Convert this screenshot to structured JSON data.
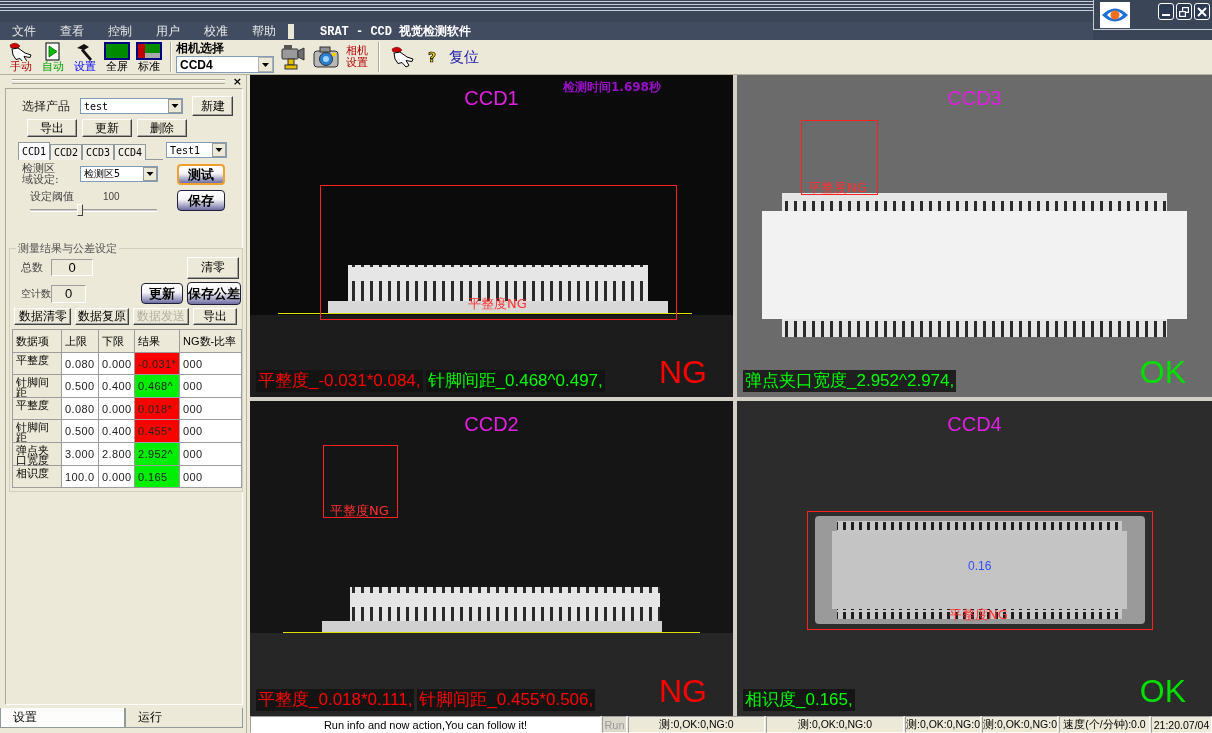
{
  "window": {
    "menu": [
      "文件",
      "查看",
      "控制",
      "用户",
      "校准",
      "帮助"
    ],
    "title": "SRAT - CCD 视觉检测软件"
  },
  "toolbar": {
    "modes": [
      "手动",
      "自动",
      "设置",
      "全屏",
      "标准"
    ],
    "camera_select": {
      "label": "相机选择",
      "value": "CCD4"
    },
    "camera_settings": "相机设置",
    "help": "?",
    "reset": "复位"
  },
  "side_panel": {
    "close": "×",
    "product": {
      "label": "选择产品",
      "value": "test"
    },
    "new_button": "新建",
    "product_buttons": [
      "导出",
      "更新",
      "删除"
    ],
    "ccd_tabs": [
      {
        "label": "CCD1",
        "selected": true
      },
      {
        "label": "CCD2",
        "selected": false
      },
      {
        "label": "CCD3",
        "selected": false
      },
      {
        "label": "CCD4",
        "selected": false
      }
    ],
    "test_select": "Test1",
    "region": {
      "label": "检测区域设定:",
      "value": "检测区5"
    },
    "threshold": {
      "label": "设定阈值",
      "reading": "100",
      "level": 0.39
    },
    "action_buttons": [
      {
        "label": "测试",
        "focused": true
      },
      {
        "label": "保存",
        "focused": false
      }
    ],
    "results": {
      "title": "测量结果与公差设定",
      "total": {
        "label": "总数",
        "value": "0"
      },
      "empty_count": {
        "label": "空计数",
        "value": "0"
      },
      "clear_button": "清零",
      "update_button": "更新",
      "save_button": "保存公差",
      "data_buttons": [
        {
          "label": "数据清零",
          "disabled": false
        },
        {
          "label": "数据复原",
          "disabled": false
        },
        {
          "label": "数据发送",
          "disabled": true
        },
        {
          "label": "导出",
          "disabled": false
        }
      ]
    },
    "table": {
      "columns": [
        "数据项",
        "上限",
        "下限",
        "结果",
        "NG数-比率"
      ],
      "rows": [
        {
          "item": "平整度",
          "upper": "0.080",
          "lower": "0.000",
          "result": "-0.031*",
          "pass": false,
          "ng": "000"
        },
        {
          "item": "针脚间距",
          "upper": "0.500",
          "lower": "0.400",
          "result": "0.468^",
          "pass": true,
          "ng": "000"
        },
        {
          "item": "平整度",
          "upper": "0.080",
          "lower": "0.000",
          "result": "0.018*",
          "pass": false,
          "ng": "000"
        },
        {
          "item": "针脚间距",
          "upper": "0.500",
          "lower": "0.400",
          "result": "0.455*",
          "pass": false,
          "ng": "000"
        },
        {
          "item": "弹点夹口宽度",
          "upper": "3.000",
          "lower": "2.800",
          "result": "2.952^",
          "pass": true,
          "ng": "000"
        },
        {
          "item": "相识度",
          "upper": "100.0",
          "lower": "0.000",
          "result": "0.165",
          "pass": true,
          "ng": "000"
        }
      ]
    },
    "bottom_tabs": [
      {
        "label": "设置",
        "selected": true
      },
      {
        "label": "运行",
        "selected": false
      }
    ]
  },
  "views": [
    {
      "name": "CCD1",
      "time": "检测时间1.698秒",
      "overlays": [
        {
          "kind": "roi",
          "text": "平整度NG"
        }
      ],
      "results": [
        {
          "text": "平整度_-0.031*0.084,",
          "ok": false
        },
        {
          "text": "针脚间距_0.468^0.497,",
          "ok": true
        }
      ],
      "verdict": "NG",
      "ok": false
    },
    {
      "name": "CCD3",
      "overlays": [
        {
          "kind": "roi",
          "text": "平整度NG"
        }
      ],
      "results": [
        {
          "text": "弹点夹口宽度_2.952^2.974,",
          "ok": true
        }
      ],
      "verdict": "OK",
      "ok": true
    },
    {
      "name": "CCD2",
      "overlays": [
        {
          "kind": "roi",
          "text": "平整度NG"
        }
      ],
      "results": [
        {
          "text": "平整度_0.018*0.111,",
          "ok": false
        },
        {
          "text": "针脚间距_0.455*0.506,",
          "ok": false
        }
      ],
      "verdict": "NG",
      "ok": false
    },
    {
      "name": "CCD4",
      "overlays": [
        {
          "kind": "value",
          "text": "0.16"
        },
        {
          "kind": "roi",
          "text": "平整度NG"
        }
      ],
      "results": [
        {
          "text": "相识度_0.165,",
          "ok": true
        }
      ],
      "verdict": "OK",
      "ok": true
    }
  ],
  "status_bar": {
    "message": "Run info and now action,You can follow it!",
    "run": "Run",
    "counts": [
      "测:0,OK:0,NG:0",
      "测:0,OK:0,NG:0",
      "测:0,OK:0,NG:0",
      "测:0,OK:0,NG:0"
    ],
    "speed": "速度(个/分钟):0.0",
    "time": "21:20.07/04"
  }
}
